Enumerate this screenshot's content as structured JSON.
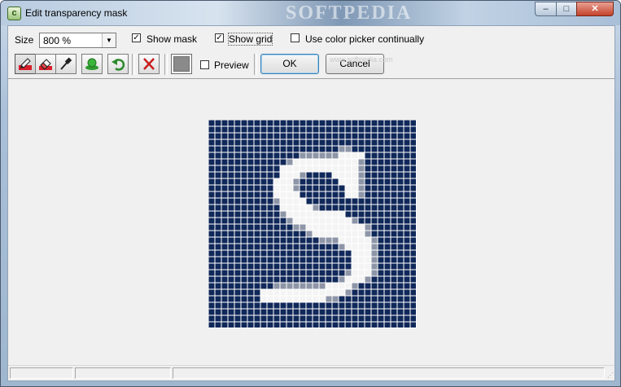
{
  "window": {
    "title": "Edit transparency mask",
    "watermark": "SOFTPEDIA",
    "controls": {
      "minimize": "–",
      "maximize": "□",
      "close": "✕"
    }
  },
  "options": {
    "size_label": "Size",
    "size_value": "800 %",
    "show_mask_label": "Show mask",
    "show_mask_checked": true,
    "show_grid_label": "Show grid",
    "show_grid_checked": true,
    "color_picker_label": "Use color picker continually",
    "color_picker_checked": false
  },
  "toolbar": {
    "tools": [
      "pencil-icon",
      "eraser-icon",
      "eyedropper-icon",
      "fill-icon",
      "undo-icon",
      "clear-icon"
    ],
    "preview_label": "Preview",
    "preview_checked": false,
    "ok_label": "OK",
    "cancel_label": "Cancel",
    "faint_text": "www.softpedia.com",
    "current_color": "#8a8a8a"
  },
  "canvas": {
    "background": "#10285a",
    "grid_color": "#ffffff",
    "cell_count": 32,
    "mask_rows": [
      "................................",
      "................................",
      "................................",
      "................................",
      "....................gg..........",
      "..............ggggggwwww........",
      "............gwwwwwwwwwwg........",
      "...........wwwwwwwwwwwwg........",
      "...........wwwg....wwwwg........",
      "..........wwwg......wwwg........",
      "..........wwwg.......wwg........",
      "..........wwww.......wwg........",
      "..........gwwww.................",
      "...........wwwwwg................",
      "...........gwwwwwwwww............",
      "............gwwwwwwwwwg.........",
      ".............ggwwwwwwwwwg........",
      "...............gwwwwwwwwg........",
      ".................gggwwwwwg.......",
      "....................gwwwwg.......",
      "......................wwwg.......",
      "......................wwwg.......",
      "......................wwwg.......",
      ".....................gwwwg.......",
      "....................gwwwg........",
      "..........ggggggggwwwwg.........",
      "........wwwwwwwwwwwwwg..........",
      "........wwwwwwwwwwgg............",
      "................................",
      "................................",
      "................................",
      "................................"
    ],
    "mask_white": "#f4f4f4",
    "mask_gray": "#8d95a7"
  },
  "statusbar": {
    "panel1": "",
    "panel2": "",
    "panel3": ""
  }
}
